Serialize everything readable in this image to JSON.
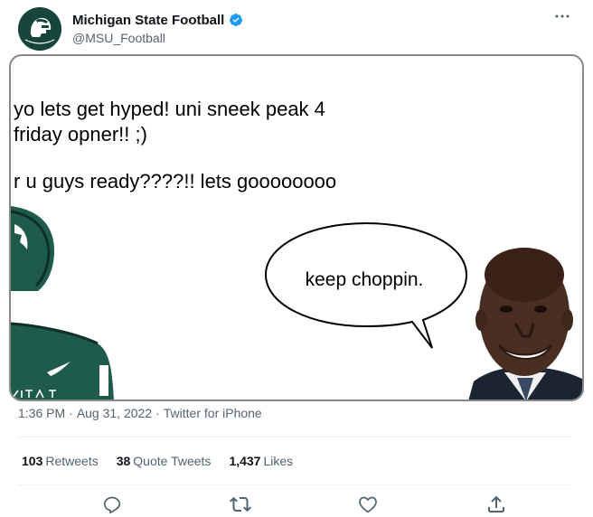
{
  "account": {
    "display_name": "Michigan State Football",
    "handle": "@MSU_Football",
    "verified": true,
    "avatar_icon": "spartan-helmet-icon"
  },
  "more_icon": "more-horizontal-icon",
  "media": {
    "lines": [
      "yo lets get hyped! uni sneek peak 4",
      "friday opner!! ;)",
      "r u guys ready????!! lets goooooooo"
    ],
    "speech_bubble": "keep choppin."
  },
  "timestamp": {
    "time": "1:36 PM",
    "date": "Aug 31, 2022",
    "source": "Twitter for iPhone",
    "separator": "·"
  },
  "stats": {
    "retweets_count": "103",
    "retweets_label": "Retweets",
    "quotes_count": "38",
    "quotes_label": "Quote Tweets",
    "likes_count": "1,437",
    "likes_label": "Likes"
  },
  "actions": [
    "reply-icon",
    "retweet-icon",
    "like-icon",
    "share-icon"
  ],
  "colors": {
    "brand_green": "#18453b",
    "verified_blue": "#1d9bf0",
    "secondary_text": "#536471"
  }
}
